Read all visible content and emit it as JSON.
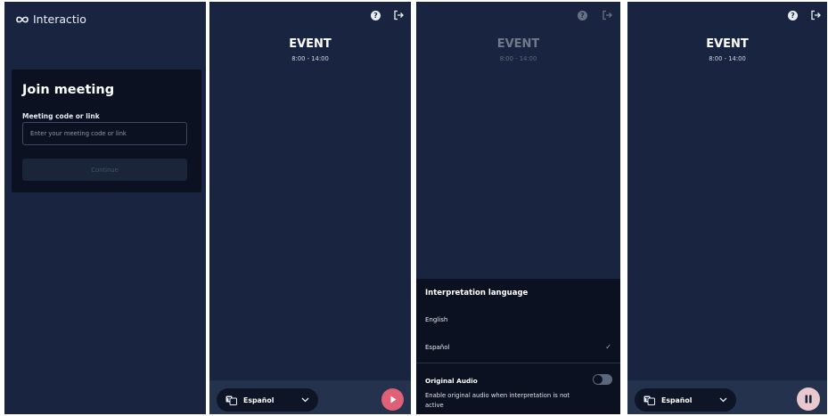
{
  "brand": {
    "name": "Interactio"
  },
  "join": {
    "title": "Join meeting",
    "field_label": "Meeting code or link",
    "placeholder": "Enter your meeting code or link",
    "continue_label": "Continue"
  },
  "event": {
    "title": "EVENT",
    "time": "8:00 - 14:00"
  },
  "player": {
    "language": "Español"
  },
  "language_sheet": {
    "title": "Interpretation language",
    "options": [
      "English",
      "Español"
    ],
    "selected": "Español",
    "original_audio_label": "Original Audio",
    "original_audio_desc": "Enable original audio when interpretation is not active",
    "original_audio_enabled": false
  },
  "icons": {
    "help": "help-circle-icon",
    "exit": "logout-icon",
    "language": "translate-icon",
    "play": "play-icon",
    "pause": "pause-icon"
  },
  "colors": {
    "background": "#192540",
    "card": "#0b1120",
    "play_button": "#e06077",
    "pause_button": "#e9c8d0"
  }
}
